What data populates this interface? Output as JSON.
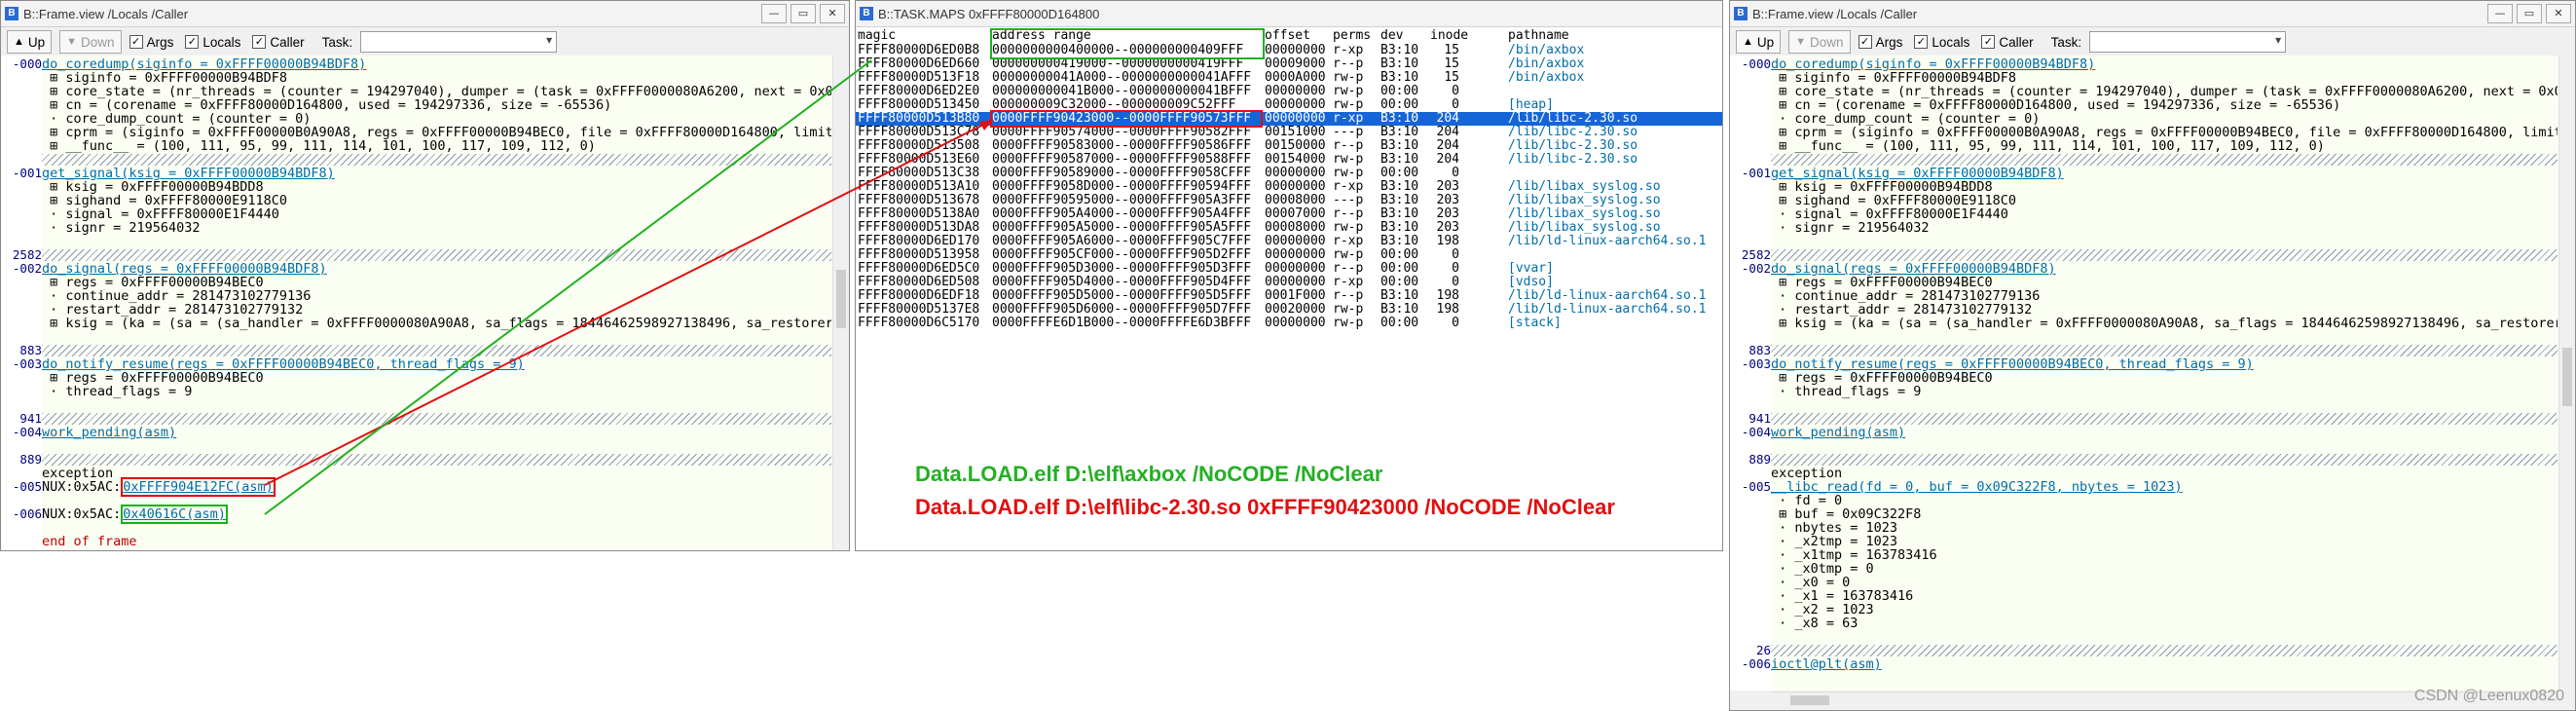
{
  "left_window": {
    "title": "B::Frame.view /Locals /Caller",
    "toolbar": {
      "up": "Up",
      "down": "Down",
      "args": "Args",
      "locals": "Locals",
      "caller": "Caller",
      "task": "Task:"
    },
    "lines": [
      {
        "g": "-000",
        "t": "do_coredump(siginfo = 0xFFFF00000B94BDF8)",
        "k": "fn"
      },
      {
        "g": "",
        "t": " ⊞ siginfo = 0xFFFF00000B94BDF8"
      },
      {
        "g": "",
        "t": " ⊞ core_state = (nr_threads = (counter = 194297040), dumper = (task = 0xFFFF0000080A6200, next = 0x0B"
      },
      {
        "g": "",
        "t": " ⊞ cn = (corename = 0xFFFF80000D164800, used = 194297336, size = -65536)"
      },
      {
        "g": "",
        "t": " · core_dump_count = (counter = 0)"
      },
      {
        "g": "",
        "t": " ⊞ cprm = (siginfo = 0xFFFF00000B0A90A8, regs = 0xFFFF00000B94BEC0, file = 0xFFFF80000D164800, limit"
      },
      {
        "g": "",
        "t": " ⊞ __func__ = (100, 111, 95, 99, 111, 114, 101, 100, 117, 109, 112, 0)"
      },
      {
        "g": "",
        "t": "",
        "k": "hatch"
      },
      {
        "g": "-001",
        "t": "get_signal(ksig = 0xFFFF00000B94BDF8)",
        "k": "fn"
      },
      {
        "g": "",
        "t": " ⊞ ksig = 0xFFFF00000B94BDD8"
      },
      {
        "g": "",
        "t": " ⊞ sighand = 0xFFFF80000E9118C0"
      },
      {
        "g": "",
        "t": " · signal = 0xFFFF80000E1F4440"
      },
      {
        "g": "",
        "t": " · signr = 219564032"
      },
      {
        "g": "",
        "t": "",
        "k": "blank"
      },
      {
        "g": "2582",
        "t": "",
        "k": "hatch"
      },
      {
        "g": "-002",
        "t": "do_signal(regs = 0xFFFF00000B94BDF8)",
        "k": "fn"
      },
      {
        "g": "",
        "t": " ⊞ regs = 0xFFFF00000B94BEC0"
      },
      {
        "g": "",
        "t": " · continue_addr = 281473102779136"
      },
      {
        "g": "",
        "t": " · restart_addr = 281473102779132"
      },
      {
        "g": "",
        "t": " ⊞ ksig = (ka = (sa = (sa_handler = 0xFFFF0000080A90A8, sa_flags = 18446462598927138496, sa_restorer"
      },
      {
        "g": "",
        "t": "",
        "k": "blank"
      },
      {
        "g": "883",
        "t": "",
        "k": "hatch"
      },
      {
        "g": "-003",
        "t": "do_notify_resume(regs = 0xFFFF00000B94BEC0, thread_flags = 9)",
        "k": "fn"
      },
      {
        "g": "",
        "t": " ⊞ regs = 0xFFFF00000B94BEC0"
      },
      {
        "g": "",
        "t": " · thread_flags = 9"
      },
      {
        "g": "",
        "t": "",
        "k": "blank"
      },
      {
        "g": "941",
        "t": "",
        "k": "hatch"
      },
      {
        "g": "-004",
        "t": "work_pending(asm)",
        "k": "fn"
      },
      {
        "g": "",
        "t": "",
        "k": "blank"
      },
      {
        "g": "889",
        "t": "",
        "k": "hatch"
      },
      {
        "g": "",
        "t": "exception"
      },
      {
        "g": "-005",
        "t": "NUX:0x5AC:",
        "box": "0xFFFF904E12FC(asm)",
        "bc": "red"
      },
      {
        "g": "",
        "t": "",
        "k": "blank"
      },
      {
        "g": "-006",
        "t": "NUX:0x5AC:",
        "box": "0x40616C(asm)",
        "bc": "green"
      },
      {
        "g": "",
        "t": "",
        "k": "blank"
      },
      {
        "g": "",
        "t": "end of frame",
        "k": "red"
      }
    ]
  },
  "maps_window": {
    "title": "B::TASK.MAPS 0xFFFF80000D164800",
    "headers": [
      "magic",
      "address range",
      "offset",
      "perms",
      "dev",
      "inode",
      "pathname"
    ],
    "rows": [
      [
        "FFFF80000D6ED0B8",
        "0000000000400000--000000000409FFF",
        "00000000",
        "r-xp",
        "B3:10",
        "15",
        "/bin/axbox"
      ],
      [
        "FFFF80000D6ED660",
        "000000000419000--0000000000419FFF",
        "00009000",
        "r--p",
        "B3:10",
        "15",
        "/bin/axbox"
      ],
      [
        "FFFF80000D513F18",
        "00000000041A000--0000000000041AFFF",
        "0000A000",
        "rw-p",
        "B3:10",
        "15",
        "/bin/axbox"
      ],
      [
        "FFFF80000D6ED2E0",
        "000000000041B000--000000000041BFFF",
        "00000000",
        "rw-p",
        "00:00",
        "0",
        ""
      ],
      [
        "FFFF80000D513450",
        "000000009C32000--000000009C52FFF",
        "00000000",
        "rw-p",
        "00:00",
        "0",
        "[heap]"
      ],
      [
        "FFFF80000D513B80",
        "0000FFFF90423000--0000FFFF90573FFF",
        "00000000",
        "r-xp",
        "B3:10",
        "204",
        "/lib/libc-2.30.so"
      ],
      [
        "FFFF80000D513C78",
        "0000FFFF90574000--0000FFFF90582FFF",
        "00151000",
        "---p",
        "B3:10",
        "204",
        "/lib/libc-2.30.so"
      ],
      [
        "FFFF80000D513508",
        "0000FFFF90583000--0000FFFF90586FFF",
        "00150000",
        "r--p",
        "B3:10",
        "204",
        "/lib/libc-2.30.so"
      ],
      [
        "FFFF80000D513E60",
        "0000FFFF90587000--0000FFFF90588FFF",
        "00154000",
        "rw-p",
        "B3:10",
        "204",
        "/lib/libc-2.30.so"
      ],
      [
        "FFFF80000D513C38",
        "0000FFFF90589000--0000FFFF9058CFFF",
        "00000000",
        "rw-p",
        "00:00",
        "0",
        ""
      ],
      [
        "FFFF80000D513A10",
        "0000FFFF9058D000--0000FFFF90594FFF",
        "00000000",
        "r-xp",
        "B3:10",
        "203",
        "/lib/libax_syslog.so"
      ],
      [
        "FFFF80000D513678",
        "0000FFFF90595000--0000FFFF905A3FFF",
        "00008000",
        "---p",
        "B3:10",
        "203",
        "/lib/libax_syslog.so"
      ],
      [
        "FFFF80000D5138A0",
        "0000FFFF905A4000--0000FFFF905A4FFF",
        "00007000",
        "r--p",
        "B3:10",
        "203",
        "/lib/libax_syslog.so"
      ],
      [
        "FFFF80000D513DA8",
        "0000FFFF905A5000--0000FFFF905A5FFF",
        "00008000",
        "rw-p",
        "B3:10",
        "203",
        "/lib/libax_syslog.so"
      ],
      [
        "FFFF80000D6ED170",
        "0000FFFF905A6000--0000FFFF905C7FFF",
        "00000000",
        "r-xp",
        "B3:10",
        "198",
        "/lib/ld-linux-aarch64.so.1"
      ],
      [
        "FFFF80000D513958",
        "0000FFFF905CF000--0000FFFF905D2FFF",
        "00000000",
        "rw-p",
        "00:00",
        "0",
        ""
      ],
      [
        "FFFF80000D6ED5C0",
        "0000FFFF905D3000--0000FFFF905D3FFF",
        "00000000",
        "r--p",
        "00:00",
        "0",
        "[vvar]"
      ],
      [
        "FFFF80000D6ED508",
        "0000FFFF905D4000--0000FFFF905D4FFF",
        "00000000",
        "r-xp",
        "00:00",
        "0",
        "[vdso]"
      ],
      [
        "FFFF80000D6EDF18",
        "0000FFFF905D5000--0000FFFF905D5FFF",
        "0001F000",
        "r--p",
        "B3:10",
        "198",
        "/lib/ld-linux-aarch64.so.1"
      ],
      [
        "FFFF80000D5137E8",
        "0000FFFF905D6000--0000FFFF905D7FFF",
        "00020000",
        "rw-p",
        "B3:10",
        "198",
        "/lib/ld-linux-aarch64.so.1"
      ],
      [
        "FFFF80000D6C5170",
        "0000FFFFE6D1B000--0000FFFFE6D3BFFF",
        "00000000",
        "rw-p",
        "00:00",
        "0",
        "[stack]"
      ]
    ],
    "selected_row": 5
  },
  "notes": {
    "green": "Data.LOAD.elf D:\\elf\\axbox /NoCODE /NoClear",
    "red": "Data.LOAD.elf D:\\elf\\libc-2.30.so 0xFFFF90423000 /NoCODE /NoClear"
  },
  "right_window": {
    "title": "B::Frame.view /Locals /Caller",
    "toolbar": {
      "up": "Up",
      "down": "Down",
      "args": "Args",
      "locals": "Locals",
      "caller": "Caller",
      "task": "Task:"
    },
    "lines": [
      {
        "g": "-000",
        "t": "do_coredump(siginfo = 0xFFFF00000B94BDF8)",
        "k": "fn"
      },
      {
        "g": "",
        "t": " ⊞ siginfo = 0xFFFF00000B94BDF8"
      },
      {
        "g": "",
        "t": " ⊞ core_state = (nr_threads = (counter = 194297040), dumper = (task = 0xFFFF0000080A6200, next = 0x0B"
      },
      {
        "g": "",
        "t": " ⊞ cn = (corename = 0xFFFF80000D164800, used = 194297336, size = -65536)"
      },
      {
        "g": "",
        "t": " · core_dump_count = (counter = 0)"
      },
      {
        "g": "",
        "t": " ⊞ cprm = (siginfo = 0xFFFF00000B0A90A8, regs = 0xFFFF00000B94BEC0, file = 0xFFFF80000D164800, limit"
      },
      {
        "g": "",
        "t": " ⊞ __func__ = (100, 111, 95, 99, 111, 114, 101, 100, 117, 109, 112, 0)"
      },
      {
        "g": "",
        "t": "",
        "k": "hatch"
      },
      {
        "g": "-001",
        "t": "get_signal(ksig = 0xFFFF00000B94BDF8)",
        "k": "fn"
      },
      {
        "g": "",
        "t": " ⊞ ksig = 0xFFFF00000B94BDD8"
      },
      {
        "g": "",
        "t": " ⊞ sighand = 0xFFFF80000E9118C0"
      },
      {
        "g": "",
        "t": " · signal = 0xFFFF80000E1F4440"
      },
      {
        "g": "",
        "t": " · signr = 219564032"
      },
      {
        "g": "",
        "t": "",
        "k": "blank"
      },
      {
        "g": "2582",
        "t": "",
        "k": "hatch"
      },
      {
        "g": "-002",
        "t": "do_signal(regs = 0xFFFF00000B94BDF8)",
        "k": "fn"
      },
      {
        "g": "",
        "t": " ⊞ regs = 0xFFFF00000B94BEC0"
      },
      {
        "g": "",
        "t": " · continue_addr = 281473102779136"
      },
      {
        "g": "",
        "t": " · restart_addr = 281473102779132"
      },
      {
        "g": "",
        "t": " ⊞ ksig = (ka = (sa = (sa_handler = 0xFFFF0000080A90A8, sa_flags = 18446462598927138496, sa_restorer"
      },
      {
        "g": "",
        "t": "",
        "k": "blank"
      },
      {
        "g": "883",
        "t": "",
        "k": "hatch"
      },
      {
        "g": "-003",
        "t": "do_notify_resume(regs = 0xFFFF00000B94BEC0, thread_flags = 9)",
        "k": "fn"
      },
      {
        "g": "",
        "t": " ⊞ regs = 0xFFFF00000B94BEC0"
      },
      {
        "g": "",
        "t": " · thread_flags = 9"
      },
      {
        "g": "",
        "t": "",
        "k": "blank"
      },
      {
        "g": "941",
        "t": "",
        "k": "hatch"
      },
      {
        "g": "-004",
        "t": "work_pending(asm)",
        "k": "fn"
      },
      {
        "g": "",
        "t": "",
        "k": "blank"
      },
      {
        "g": "889",
        "t": "",
        "k": "hatch"
      },
      {
        "g": "",
        "t": "exception"
      },
      {
        "g": "-005",
        "t": "__libc_read(fd = 0, buf = 0x09C322F8, nbytes = 1023)",
        "k": "fn"
      },
      {
        "g": "",
        "t": " · fd = 0"
      },
      {
        "g": "",
        "t": " ⊞ buf = 0x09C322F8"
      },
      {
        "g": "",
        "t": " · nbytes = 1023"
      },
      {
        "g": "",
        "t": " · _x2tmp = 1023"
      },
      {
        "g": "",
        "t": " · _x1tmp = 163783416"
      },
      {
        "g": "",
        "t": " · _x0tmp = 0"
      },
      {
        "g": "",
        "t": " · _x0 = 0"
      },
      {
        "g": "",
        "t": " · _x1 = 163783416"
      },
      {
        "g": "",
        "t": " · _x2 = 1023"
      },
      {
        "g": "",
        "t": " · _x8 = 63"
      },
      {
        "g": "",
        "t": "",
        "k": "blank"
      },
      {
        "g": "26",
        "t": "",
        "k": "hatch"
      },
      {
        "g": "-006",
        "t": "ioctl@plt(asm)",
        "k": "fn"
      }
    ]
  },
  "watermark": "CSDN @Leenux0820"
}
